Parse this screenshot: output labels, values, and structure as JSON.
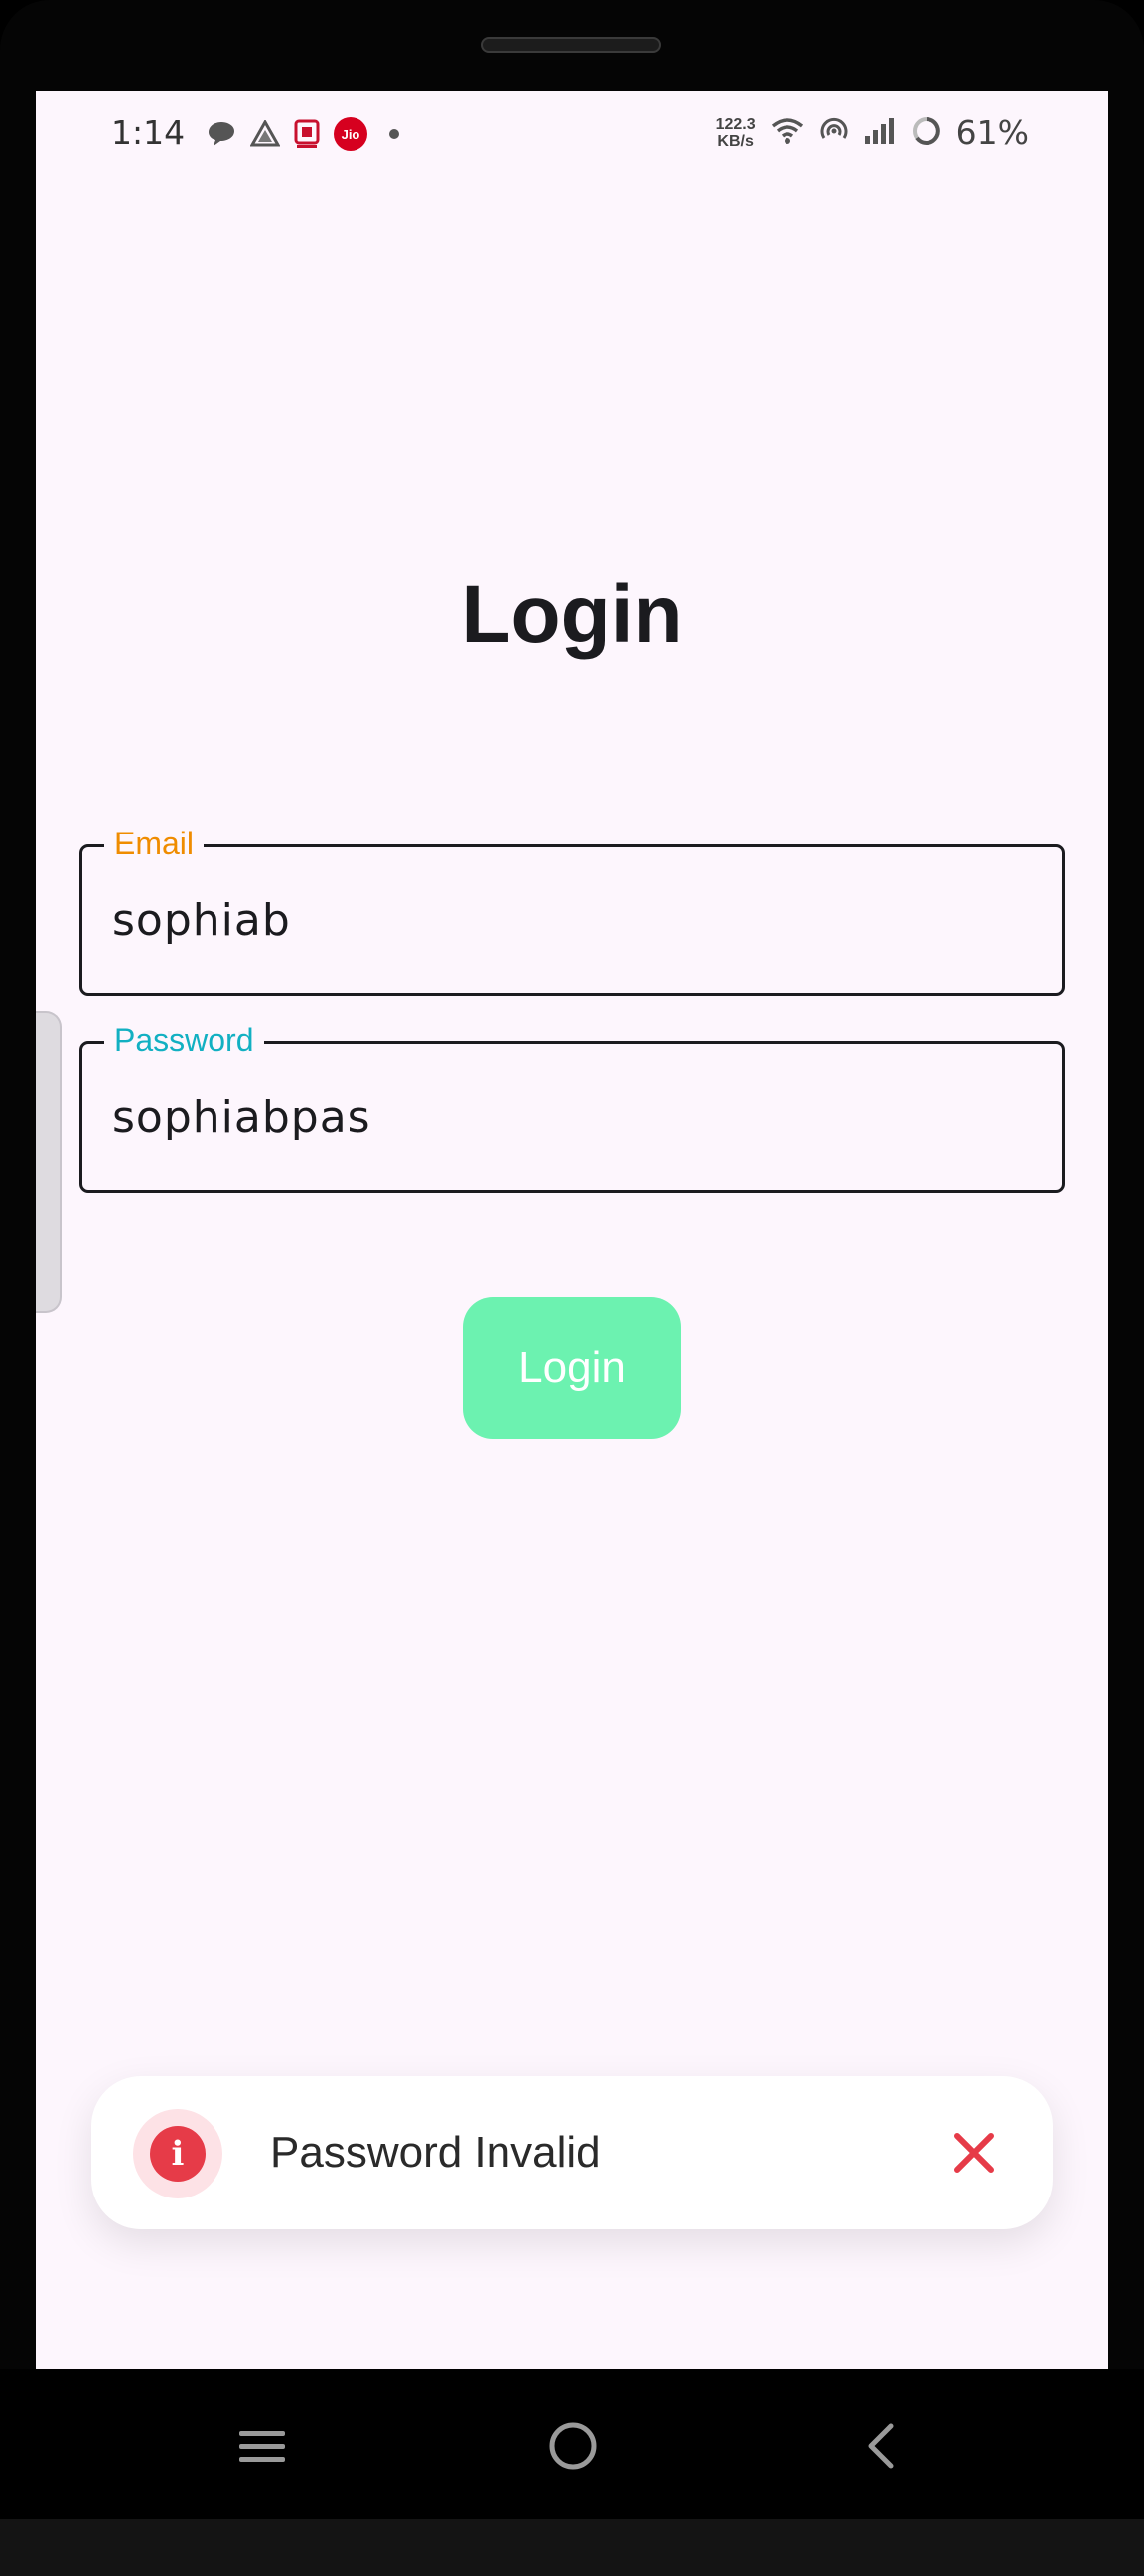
{
  "status_bar": {
    "time": "1:14",
    "notification_icons": [
      "chat-icon",
      "drive-icon",
      "app-icon",
      "jio-icon",
      "dot-icon"
    ],
    "jio_label": "Jio",
    "network_speed_value": "122.3",
    "network_speed_unit": "KB/s",
    "system_icons": [
      "wifi-icon",
      "hotspot-icon",
      "signal-icon",
      "battery-ring-icon"
    ],
    "battery_percent": "61%"
  },
  "page": {
    "title": "Login"
  },
  "form": {
    "email": {
      "label": "Email",
      "value": "sophiab",
      "label_color": "#ef8c00"
    },
    "password": {
      "label": "Password",
      "value": "sophiabpas",
      "label_color": "#12b0c2"
    },
    "submit_label": "Login",
    "submit_color": "#6cf2b0"
  },
  "toast": {
    "icon": "info-icon",
    "icon_glyph": "i",
    "message": "Password Invalid",
    "close_icon": "close-icon",
    "accent": "#e63b48"
  },
  "nav_bar": {
    "items": [
      "recents-icon",
      "home-icon",
      "back-icon"
    ]
  },
  "colors": {
    "background": "#fdf6fd",
    "text": "#1b1b1f"
  }
}
